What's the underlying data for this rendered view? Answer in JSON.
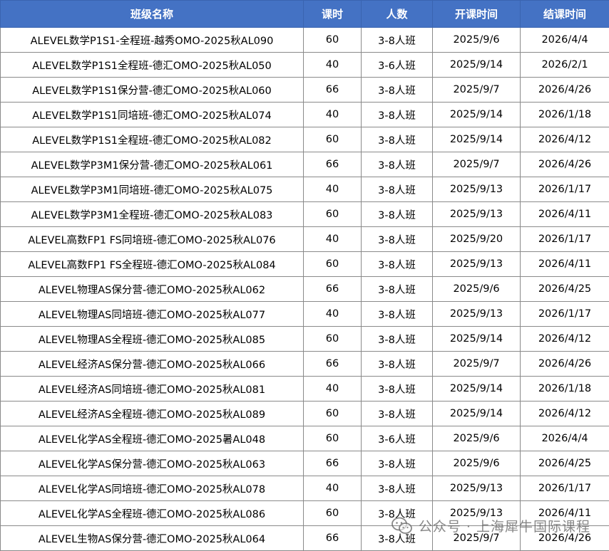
{
  "headers": [
    "班级名称",
    "课时",
    "人数",
    "开课时间",
    "结课时间"
  ],
  "rows": [
    [
      "ALEVEL数学P1S1-全程班-越秀OMO-2025秋AL090",
      "60",
      "3-8人班",
      "2025/9/6",
      "2026/4/4"
    ],
    [
      "ALEVEL数学P1S1全程班-德汇OMO-2025秋AL050",
      "40",
      "3-6人班",
      "2025/9/14",
      "2026/2/1"
    ],
    [
      "ALEVEL数学P1S1保分营-德汇OMO-2025秋AL060",
      "66",
      "3-8人班",
      "2025/9/7",
      "2026/4/26"
    ],
    [
      "ALEVEL数学P1S1同培班-德汇OMO-2025秋AL074",
      "40",
      "3-8人班",
      "2025/9/14",
      "2026/1/18"
    ],
    [
      "ALEVEL数学P1S1全程班-德汇OMO-2025秋AL082",
      "60",
      "3-8人班",
      "2025/9/14",
      "2026/4/12"
    ],
    [
      "ALEVEL数学P3M1保分营-德汇OMO-2025秋AL061",
      "66",
      "3-8人班",
      "2025/9/7",
      "2026/4/26"
    ],
    [
      "ALEVEL数学P3M1同培班-德汇OMO-2025秋AL075",
      "40",
      "3-8人班",
      "2025/9/13",
      "2026/1/17"
    ],
    [
      "ALEVEL数学P3M1全程班-德汇OMO-2025秋AL083",
      "60",
      "3-8人班",
      "2025/9/13",
      "2026/4/11"
    ],
    [
      "ALEVEL高数FP1 FS同培班-德汇OMO-2025秋AL076",
      "40",
      "3-8人班",
      "2025/9/20",
      "2026/1/17"
    ],
    [
      "ALEVEL高数FP1 FS全程班-德汇OMO-2025秋AL084",
      "60",
      "3-8人班",
      "2025/9/13",
      "2026/4/11"
    ],
    [
      "ALEVEL物理AS保分营-德汇OMO-2025秋AL062",
      "66",
      "3-8人班",
      "2025/9/6",
      "2026/4/25"
    ],
    [
      "ALEVEL物理AS同培班-德汇OMO-2025秋AL077",
      "40",
      "3-8人班",
      "2025/9/13",
      "2026/1/17"
    ],
    [
      "ALEVEL物理AS全程班-德汇OMO-2025秋AL085",
      "60",
      "3-8人班",
      "2025/9/14",
      "2026/4/12"
    ],
    [
      "ALEVEL经济AS保分营-德汇OMO-2025秋AL066",
      "66",
      "3-8人班",
      "2025/9/7",
      "2026/4/26"
    ],
    [
      "ALEVEL经济AS同培班-德汇OMO-2025秋AL081",
      "40",
      "3-8人班",
      "2025/9/14",
      "2026/1/18"
    ],
    [
      "ALEVEL经济AS全程班-德汇OMO-2025秋AL089",
      "60",
      "3-8人班",
      "2025/9/14",
      "2026/4/12"
    ],
    [
      "ALEVEL化学AS全程班-德汇OMO-2025暑AL048",
      "60",
      "3-6人班",
      "2025/9/6",
      "2026/4/4"
    ],
    [
      "ALEVEL化学AS保分营-德汇OMO-2025秋AL063",
      "66",
      "3-8人班",
      "2025/9/6",
      "2026/4/25"
    ],
    [
      "ALEVEL化学AS同培班-德汇OMO-2025秋AL078",
      "40",
      "3-8人班",
      "2025/9/13",
      "2026/1/17"
    ],
    [
      "ALEVEL化学AS全程班-德汇OMO-2025秋AL086",
      "60",
      "3-8人班",
      "2025/9/13",
      "2026/4/11"
    ],
    [
      "ALEVEL生物AS保分营-德汇OMO-2025秋AL064",
      "66",
      "3-8人班",
      "2025/9/7",
      "2026/4/26"
    ]
  ],
  "watermark": "公众号 · 上海犀牛国际课程",
  "colors": {
    "header_bg": "#4472c4",
    "header_text": "#ffffff",
    "grid": "#8a8a8a"
  },
  "icons": {
    "watermark": "wechat-icon"
  }
}
